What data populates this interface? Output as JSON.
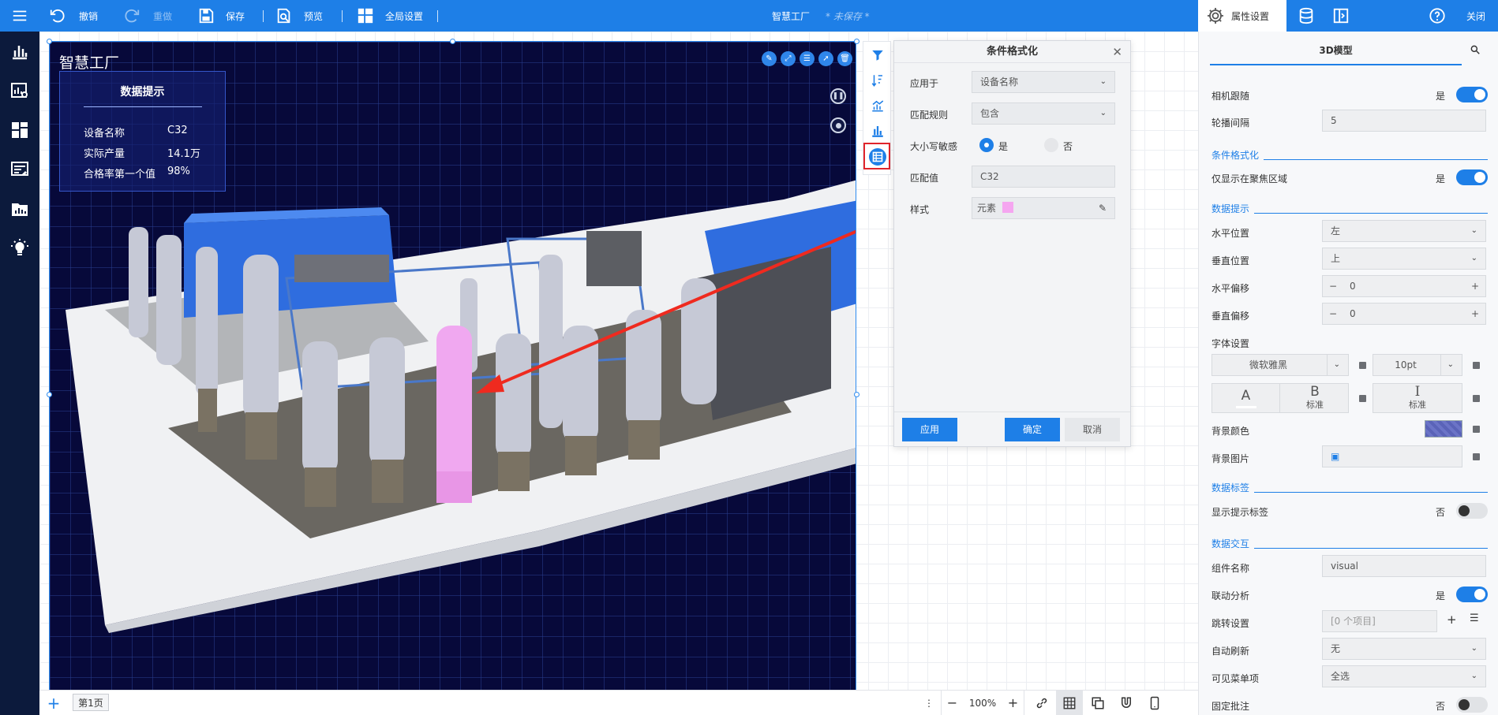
{
  "topbar": {
    "menu_icon": "hamburger-icon",
    "undo_label": "撤销",
    "redo_label": "重做",
    "save_label": "保存",
    "preview_label": "预览",
    "global_settings_label": "全局设置",
    "doc_title": "智慧工厂",
    "unsaved_label": "* 未保存 *",
    "property_tab_label": "属性设置",
    "close_label": "关闭"
  },
  "leftnav": {
    "icons": [
      "chart-bar-icon",
      "chart-search-icon",
      "dashboard-grid-icon",
      "report-icon",
      "folder-chart-icon",
      "lightbulb-icon"
    ]
  },
  "scene": {
    "title": "智慧工厂",
    "tip": {
      "title": "数据提示",
      "rows": [
        {
          "key": "设备名称",
          "value": "C32"
        },
        {
          "key": "实际产量",
          "value": "14.1万"
        },
        {
          "key": "合格率第一个值",
          "value": "98%"
        }
      ]
    },
    "action_icons": [
      "edit-icon",
      "fullscreen-icon",
      "comment-icon",
      "share-icon",
      "delete-icon"
    ]
  },
  "dialog": {
    "title": "条件格式化",
    "apply_to_label": "应用于",
    "apply_to_value": "设备名称",
    "match_rule_label": "匹配规则",
    "match_rule_value": "包含",
    "case_label": "大小写敏感",
    "case_yes": "是",
    "case_no": "否",
    "match_value_label": "匹配值",
    "match_value": "C32",
    "style_label": "样式",
    "style_value": "元素",
    "style_color": "#f5a6f0",
    "apply_button": "应用",
    "ok_button": "确定",
    "cancel_button": "取消"
  },
  "rpanel": {
    "tab_label": "3D模型",
    "camera_follow_label": "相机跟随",
    "camera_follow_value": "是",
    "carousel_label": "轮播间隔",
    "carousel_value": "5",
    "cond_section": "条件格式化",
    "focus_only_label": "仅显示在聚焦区域",
    "focus_only_value": "是",
    "tip_section": "数据提示",
    "h_pos_label": "水平位置",
    "h_pos_value": "左",
    "v_pos_label": "垂直位置",
    "v_pos_value": "上",
    "h_off_label": "水平偏移",
    "h_off_value": "0",
    "v_off_label": "垂直偏移",
    "v_off_value": "0",
    "font_label": "字体设置",
    "font_family": "微软雅黑",
    "font_size": "10pt",
    "font_a": "A",
    "font_b": "B",
    "font_b_sub": "标准",
    "font_i": "I",
    "font_i_sub": "标准",
    "bg_color_label": "背景颜色",
    "bg_image_label": "背景图片",
    "label_section": "数据标签",
    "show_tip_label": "显示提示标签",
    "show_tip_value": "否",
    "interaction_section": "数据交互",
    "comp_name_label": "组件名称",
    "comp_name_value": "visual",
    "linkage_label": "联动分析",
    "linkage_value": "是",
    "jump_label": "跳转设置",
    "jump_value": "[0 个项目]",
    "auto_refresh_label": "自动刷新",
    "auto_refresh_value": "无",
    "menu_items_label": "可见菜单项",
    "menu_items_value": "全选",
    "fixed_note_label": "固定批注",
    "fixed_note_value": "否"
  },
  "bottombar": {
    "add_label": "+",
    "page_tab": "第1页",
    "zoom_minus": "−",
    "zoom_value": "100%",
    "zoom_plus": "+"
  }
}
